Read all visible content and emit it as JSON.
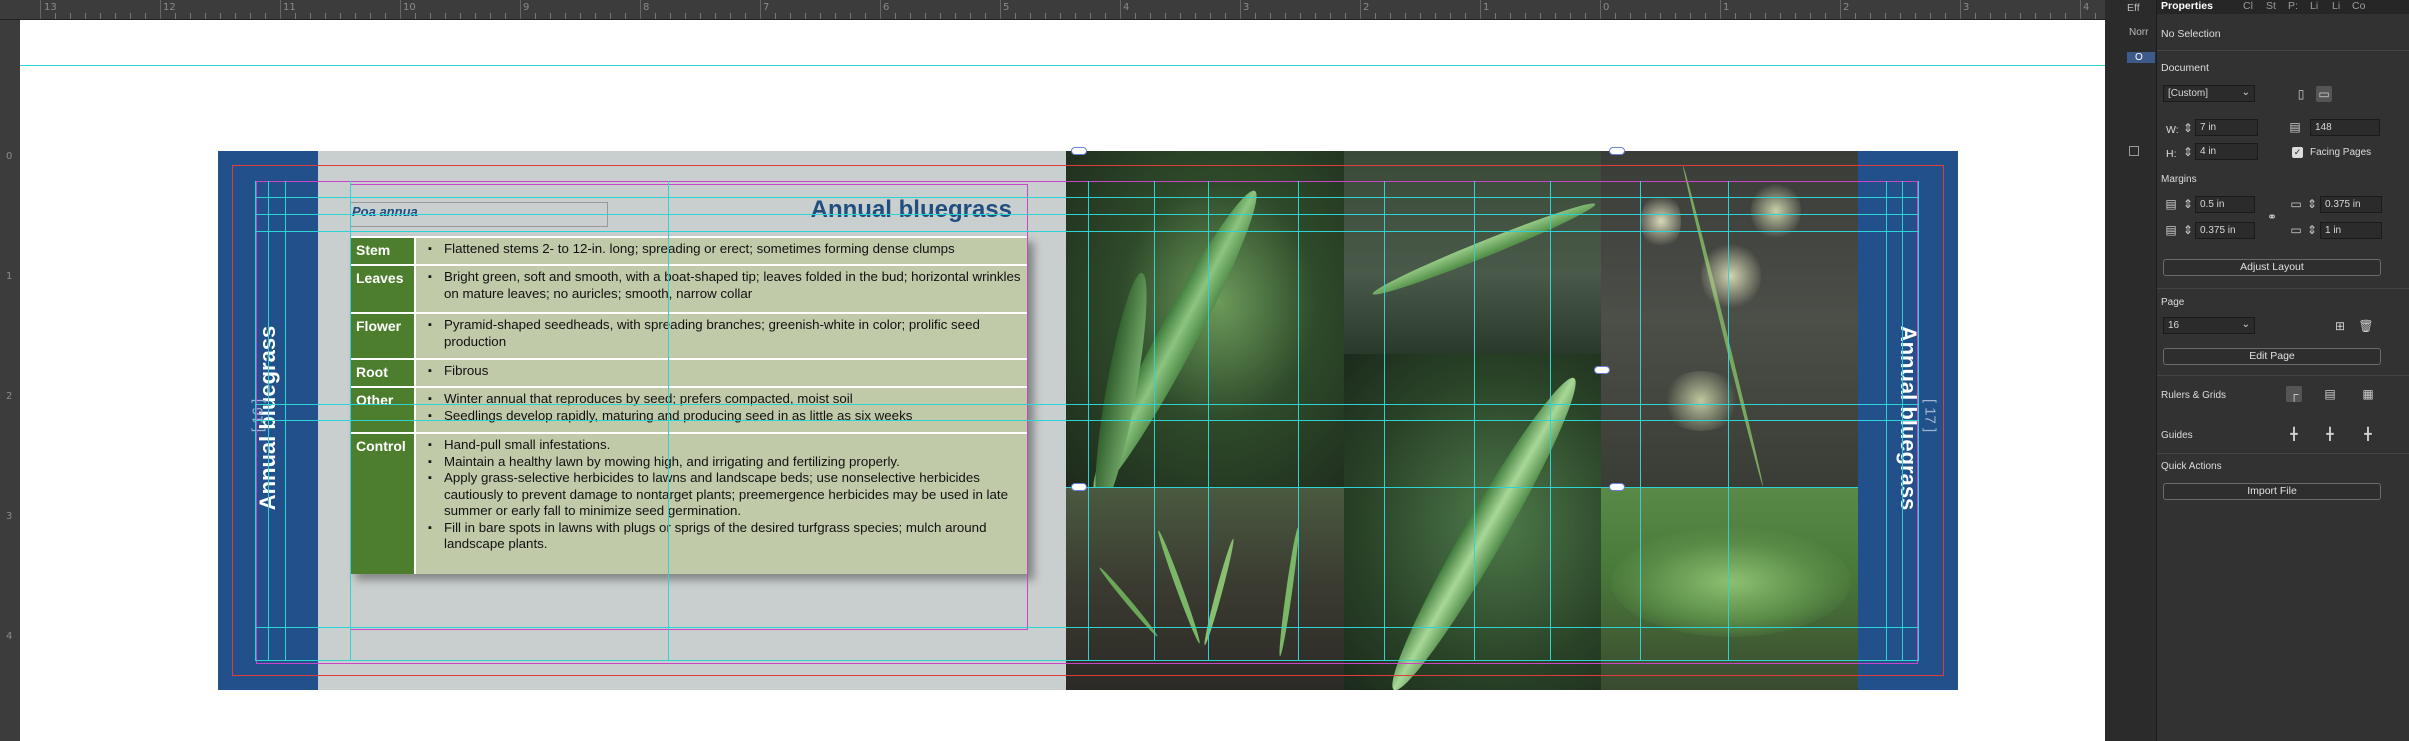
{
  "ruler": {
    "numbers": [
      "13",
      "12",
      "11",
      "10",
      "9",
      "8",
      "7",
      "6",
      "5",
      "4",
      "3",
      "2",
      "1",
      "0",
      "1",
      "2",
      "3",
      "4"
    ],
    "left_numbers": [
      "0",
      "1",
      "2",
      "3",
      "4"
    ]
  },
  "document": {
    "left_tab_title": "Annual bluegrass",
    "right_tab_title": "Annual bluegrass",
    "left_page_number": "[ 16 ]",
    "right_page_number": "[ 17 ]",
    "scientific_name": "Poa annua",
    "main_title": "Annual bluegrass",
    "table": [
      {
        "header": "Stem",
        "items": [
          "Flattened stems 2- to 12-in. long; spreading or erect; sometimes forming dense clumps"
        ]
      },
      {
        "header": "Leaves",
        "items": [
          "Bright green, soft and smooth, with a boat-shaped tip; leaves folded in the bud; horizontal wrinkles on mature leaves; no auricles; smooth, narrow collar"
        ]
      },
      {
        "header": "Flower",
        "items": [
          "Pyramid-shaped seedheads, with spreading branches; greenish-white in color; prolific seed production"
        ]
      },
      {
        "header": "Root",
        "items": [
          "Fibrous"
        ]
      },
      {
        "header": "Other",
        "items": [
          "Winter annual that reproduces by seed; prefers compacted, moist soil",
          "Seedlings develop rapidly, maturing and producing seed in as little as six weeks"
        ]
      },
      {
        "header": "Control",
        "items": [
          "Hand-pull small infestations.",
          "Maintain a healthy lawn by mowing high, and irrigating and fertilizing properly.",
          "Apply grass-selective herbicides to lawns and landscape beds; use nonselective herbicides cautiously to prevent damage to nontarget plants; preemergence herbicides may be used in late summer or early fall to minimize seed germination.",
          "Fill in bare spots in lawns with plugs or sprigs of the desired turfgrass species; mulch around landscape plants."
        ]
      }
    ]
  },
  "strip": {
    "items": [
      "Eff",
      "Norr",
      "O"
    ]
  },
  "panel": {
    "tabs": [
      "Properties",
      "Cl",
      "St",
      "P:",
      "Li",
      "Li",
      "Co"
    ],
    "selection": "No Selection",
    "document_label": "Document",
    "preset": "[Custom]",
    "w_label": "W:",
    "w_value": "7 in",
    "h_label": "H:",
    "h_value": "4 in",
    "pages_value": "148",
    "facing_pages": "Facing Pages",
    "margins_label": "Margins",
    "margin_top": "0.5 in",
    "margin_bottom": "0.375 in",
    "margin_inside": "0.375 in",
    "margin_outside": "1 in",
    "adjust_layout": "Adjust Layout",
    "page_label": "Page",
    "page_value": "16",
    "edit_page": "Edit Page",
    "rulers_grids": "Rulers & Grids",
    "guides": "Guides",
    "quick_actions": "Quick Actions",
    "import_file": "Import File"
  },
  "colors": {
    "tab_blue": "#22508a",
    "header_green": "#4d7e2d",
    "cell_sage": "#c0c9a8",
    "guide_cyan": "#2ed4d4",
    "margin_magenta": "#c845c8"
  }
}
